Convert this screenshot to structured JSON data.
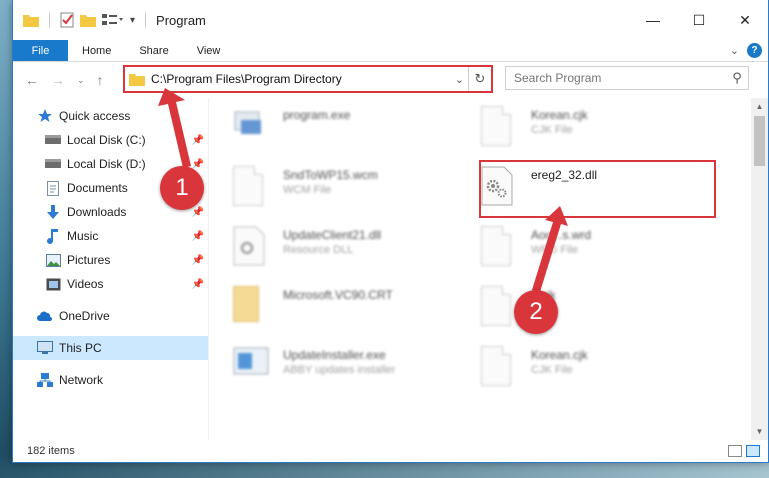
{
  "window": {
    "title": "Program",
    "controls": [
      "—",
      "☐",
      "✕"
    ]
  },
  "ribbon": {
    "file": "File",
    "tabs": [
      "Home",
      "Share",
      "View"
    ]
  },
  "address": {
    "path": "C:\\Program Files\\Program Directory"
  },
  "search": {
    "placeholder": "Search Program"
  },
  "sidebar": {
    "items": [
      {
        "label": "Quick access",
        "icon": "star-icon"
      },
      {
        "label": "Local Disk (C:)",
        "icon": "drive-icon",
        "pinned": true
      },
      {
        "label": "Local Disk (D:)",
        "icon": "drive-icon",
        "pinned": true
      },
      {
        "label": "Documents",
        "icon": "documents-icon",
        "pinned": true
      },
      {
        "label": "Downloads",
        "icon": "download-icon",
        "pinned": true
      },
      {
        "label": "Music",
        "icon": "music-icon",
        "pinned": true
      },
      {
        "label": "Pictures",
        "icon": "pictures-icon",
        "pinned": true
      },
      {
        "label": "Videos",
        "icon": "videos-icon",
        "pinned": true
      },
      {
        "label": "OneDrive",
        "icon": "cloud-icon"
      },
      {
        "label": "This PC",
        "icon": "computer-icon"
      },
      {
        "label": "Network",
        "icon": "network-icon"
      }
    ]
  },
  "files": [
    {
      "name": "program.exe",
      "type": "",
      "icon": "exe-icon"
    },
    {
      "name": "Korean.cjk",
      "type": "CJK File",
      "icon": "doc-icon"
    },
    {
      "name": "SndToWP15.wcm",
      "type": "WCM File",
      "icon": "doc-icon"
    },
    {
      "name": "ereg2_32.dll",
      "type": "",
      "icon": "dll-gear-icon"
    },
    {
      "name": "UpdateClient21.dll",
      "type": "Resource DLL",
      "icon": "dll-gear-icon"
    },
    {
      "name": "Aoo...s.wrd",
      "type": "WRD File",
      "icon": "doc-icon"
    },
    {
      "name": "Microsoft.VC90.CRT",
      "type": "",
      "icon": "folder-icon"
    },
    {
      "name": "...cjk",
      "type": "...File",
      "icon": "doc-icon"
    },
    {
      "name": "UpdateInstaller.exe",
      "type": "ABBY updates installer",
      "icon": "installer-icon"
    },
    {
      "name": "Korean.cjk",
      "type": "CJK File",
      "icon": "doc-icon"
    }
  ],
  "status": {
    "count": "182 items"
  },
  "annotations": {
    "badge1": "1",
    "badge2": "2",
    "color": "#d9363c"
  }
}
